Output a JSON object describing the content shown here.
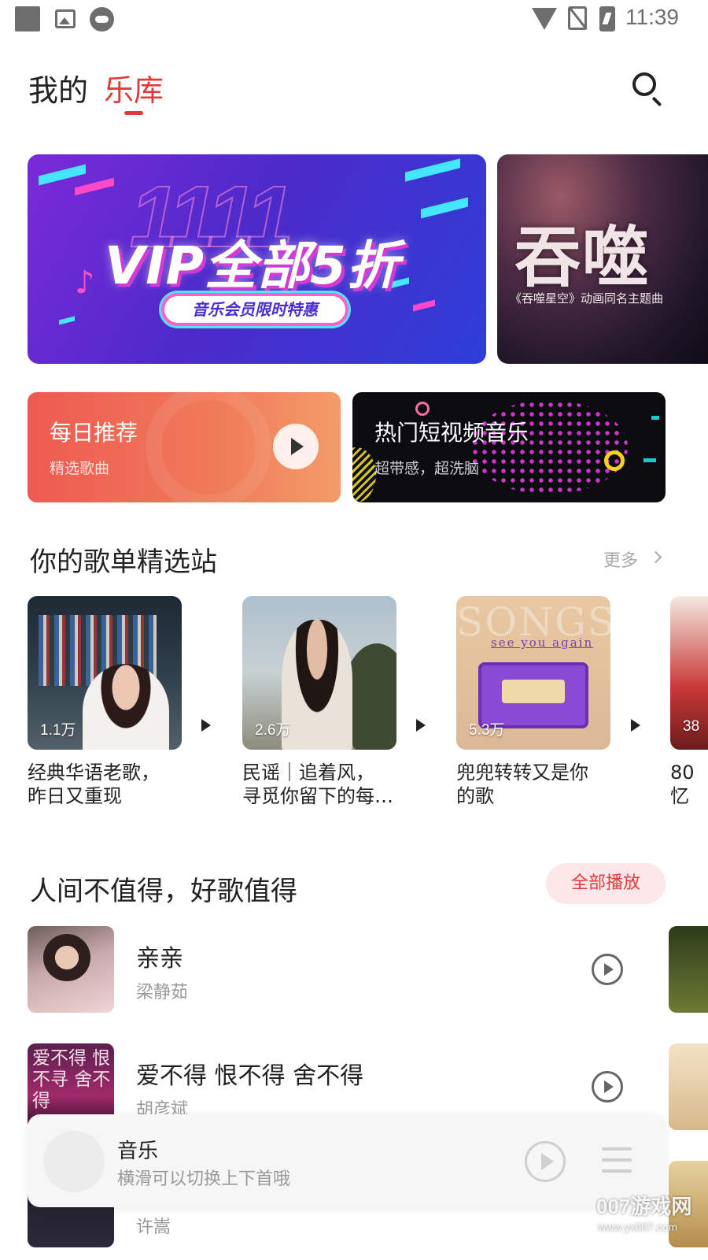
{
  "status_bar": {
    "time": "11:39"
  },
  "header": {
    "tab_mine": "我的",
    "tab_library": "乐库",
    "active_color": "#e03a3a"
  },
  "banners": [
    {
      "title": "VIP全部5折",
      "bg_text": "1111",
      "pill": "音乐会员限时特惠"
    },
    {
      "title": "吞噬",
      "subtitle": "《吞噬星空》动画同名主题曲"
    }
  ],
  "quick_cards": [
    {
      "title": "每日推荐",
      "subtitle": "精选歌曲"
    },
    {
      "title": "热门短视频音乐",
      "subtitle": "超带感，超洗脑"
    }
  ],
  "playlist_section": {
    "title": "你的歌单精选站",
    "more": "更多",
    "items": [
      {
        "count": "1.1万",
        "name_line1": "经典华语老歌，",
        "name_line2": "昨日又重现"
      },
      {
        "count": "2.6万",
        "name_line1": "民谣｜追着风，",
        "name_line2": "寻觅你留下的每一…"
      },
      {
        "count": "5.3万",
        "name_line1": "兜兜转转又是你",
        "name_line2": "的歌",
        "cover_text": "SONGS",
        "cover_sub": "see you again"
      },
      {
        "count": "38",
        "name_line1": "80",
        "name_line2": "忆"
      }
    ]
  },
  "songs_section": {
    "title": "人间不值得，好歌值得",
    "play_all": "全部播放",
    "songs": [
      {
        "title": "亲亲",
        "artist": "梁静茹"
      },
      {
        "title": "爱不得 恨不得 舍不得",
        "artist": "胡彦斌",
        "cover_text": "爱不得 恨不寻 舍不得"
      },
      {
        "title": "",
        "artist": "许嵩"
      }
    ]
  },
  "player": {
    "title": "音乐",
    "subtitle": "横滑可以切换上下首哦"
  },
  "watermark": {
    "text": "007游戏网",
    "url": "www.yx007.com"
  }
}
